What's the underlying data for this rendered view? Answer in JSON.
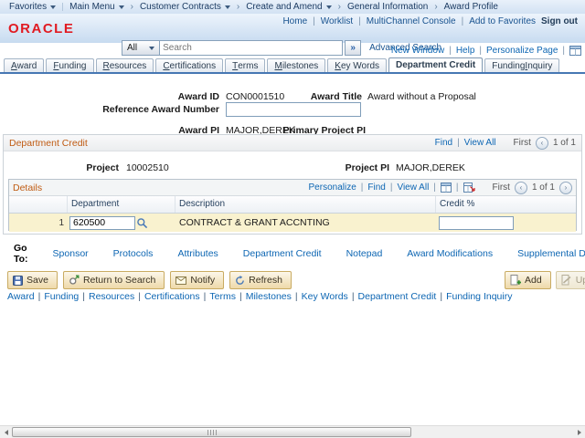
{
  "breadcrumb": {
    "items": [
      {
        "label": "Favorites"
      },
      {
        "label": "Main Menu"
      },
      {
        "label": "Customer Contracts"
      },
      {
        "label": "Create and Amend"
      },
      {
        "label": "General Information"
      },
      {
        "label": "Award Profile"
      }
    ]
  },
  "header": {
    "logo": "ORACLE",
    "links": [
      "Home",
      "Worklist",
      "MultiChannel Console",
      "Add to Favorites"
    ],
    "sign_out": "Sign out",
    "search": {
      "scope": "All",
      "placeholder": "Search",
      "go": "»",
      "advanced": "Advanced Search"
    }
  },
  "page_bar": {
    "links": [
      "New Window",
      "Help",
      "Personalize Page"
    ]
  },
  "tabs": [
    {
      "pre": "",
      "key": "A",
      "post": "ward"
    },
    {
      "pre": "",
      "key": "F",
      "post": "unding"
    },
    {
      "pre": "",
      "key": "R",
      "post": "esources"
    },
    {
      "pre": "",
      "key": "C",
      "post": "ertifications"
    },
    {
      "pre": "",
      "key": "T",
      "post": "erms"
    },
    {
      "pre": "",
      "key": "M",
      "post": "ilestones"
    },
    {
      "pre": "",
      "key": "K",
      "post": "ey Words"
    },
    {
      "pre": "Department Credit",
      "key": "",
      "post": ""
    },
    {
      "pre": "Funding ",
      "key": "I",
      "post": "nquiry"
    }
  ],
  "form": {
    "award_id_label": "Award ID",
    "award_id": "CON0001510",
    "award_title_label": "Award Title",
    "award_title": "Award without a Proposal",
    "reference_award_label": "Reference Award Number",
    "reference_award_value": "",
    "award_pi_label": "Award PI",
    "award_pi": "MAJOR,DEREK",
    "primary_pi_label": "Primary Project PI",
    "primary_pi": ""
  },
  "department_credit": {
    "title": "Department Credit",
    "find": "Find",
    "view_all": "View All",
    "first": "First",
    "position": "1 of 1",
    "project_label": "Project",
    "project": "10002510",
    "project_pi_label": "Project PI",
    "project_pi": "MAJOR,DEREK",
    "details": {
      "title": "Details",
      "personalize": "Personalize",
      "find": "Find",
      "view_all": "View All",
      "first": "First",
      "position": "1 of 1",
      "columns": [
        "Department",
        "Description",
        "Credit %"
      ],
      "rows": [
        {
          "num": "1",
          "department": "620500",
          "description": "CONTRACT & GRANT ACCNTING",
          "credit_pct": ""
        }
      ]
    }
  },
  "go_to": {
    "label": "Go To:",
    "links": [
      "Sponsor",
      "Protocols",
      "Attributes",
      "Department Credit",
      "Notepad",
      "Award Modifications",
      "Supplemental Data"
    ]
  },
  "toolbar": {
    "save": "Save",
    "return_to_search": "Return to Search",
    "notify": "Notify",
    "refresh": "Refresh",
    "add": "Add",
    "update": "Update"
  },
  "footer_links": [
    "Award",
    "Funding",
    "Resources",
    "Certifications",
    "Terms",
    "Milestones",
    "Key Words",
    "Department Credit",
    "Funding Inquiry"
  ],
  "colors": {
    "link_blue": "#0d66b3",
    "section_orange": "#bf5a11",
    "oracle_red": "#e11b22",
    "tab_line_blue": "#4677b3",
    "row_highlight_yellow": "#f9f2cf",
    "button_tan": "#eed9a9"
  }
}
